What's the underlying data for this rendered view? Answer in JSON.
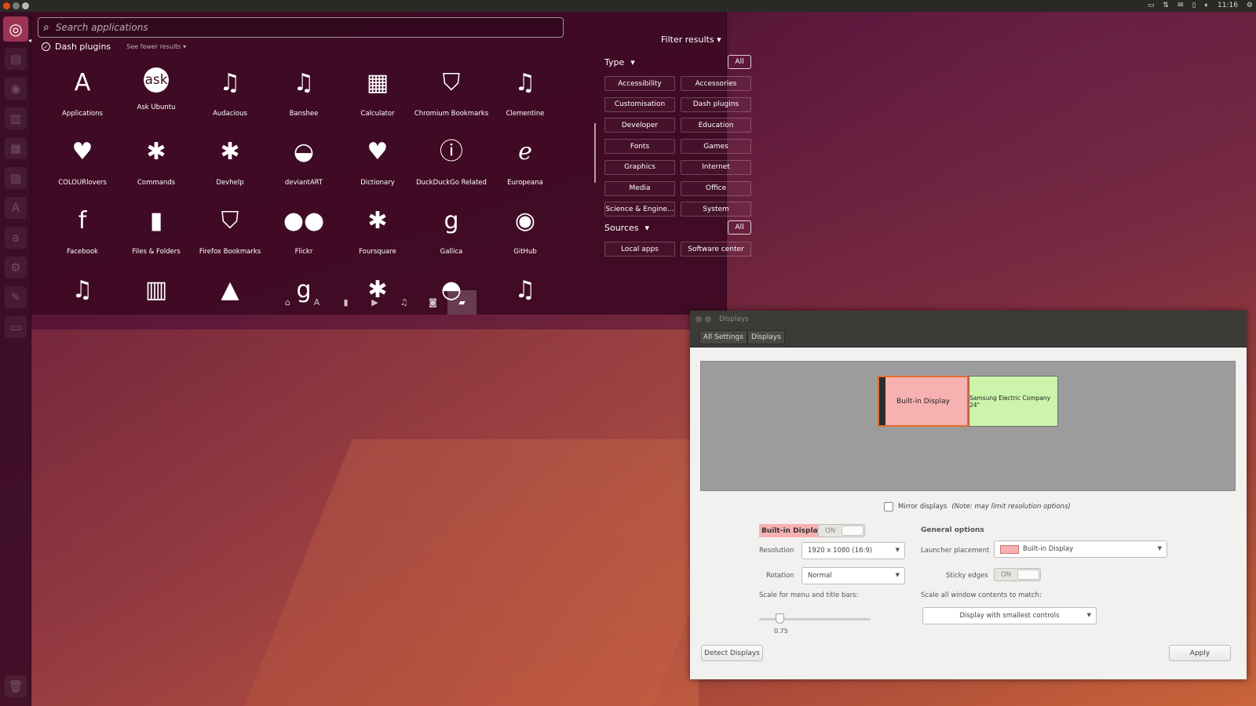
{
  "top_panel": {
    "time": "11:16",
    "tray_icons": [
      "network-icon",
      "transfer-icon",
      "mail-icon",
      "battery-icon",
      "volume-icon",
      "gear-icon"
    ]
  },
  "dash": {
    "search_placeholder": "Search applications",
    "category_title": "Dash plugins",
    "see_fewer": "See fewer results",
    "results": [
      {
        "label": "Applications",
        "icon": "A"
      },
      {
        "label": "Ask Ubuntu",
        "icon": "ask"
      },
      {
        "label": "Audacious",
        "icon": "♫"
      },
      {
        "label": "Banshee",
        "icon": "♫"
      },
      {
        "label": "Calculator",
        "icon": "▦"
      },
      {
        "label": "Chromium Bookmarks",
        "icon": "⛉"
      },
      {
        "label": "Clementine",
        "icon": "♫"
      },
      {
        "label": "COLOURlovers",
        "icon": "♥"
      },
      {
        "label": "Commands",
        "icon": "✱"
      },
      {
        "label": "Devhelp",
        "icon": "✱"
      },
      {
        "label": "deviantART",
        "icon": "◒"
      },
      {
        "label": "Dictionary",
        "icon": "♥"
      },
      {
        "label": "DuckDuckGo Related",
        "icon": "ⓘ"
      },
      {
        "label": "Europeana",
        "icon": "ℯ"
      },
      {
        "label": "Facebook",
        "icon": "f"
      },
      {
        "label": "Files & Folders",
        "icon": "▮"
      },
      {
        "label": "Firefox Bookmarks",
        "icon": "⛉"
      },
      {
        "label": "Flickr",
        "icon": "●●"
      },
      {
        "label": "Foursquare",
        "icon": "✱"
      },
      {
        "label": "Gallica",
        "icon": "g"
      },
      {
        "label": "GitHub",
        "icon": "◉"
      },
      {
        "label": "",
        "icon": "♫"
      },
      {
        "label": "",
        "icon": "▥"
      },
      {
        "label": "",
        "icon": "▲"
      },
      {
        "label": "",
        "icon": "g"
      },
      {
        "label": "",
        "icon": "✱"
      },
      {
        "label": "",
        "icon": "◓"
      },
      {
        "label": "",
        "icon": "♫"
      }
    ],
    "lenses": [
      {
        "name": "lens-home",
        "icon": "⌂"
      },
      {
        "name": "lens-applications",
        "icon": "A"
      },
      {
        "name": "lens-files",
        "icon": "▮"
      },
      {
        "name": "lens-video",
        "icon": "▶"
      },
      {
        "name": "lens-music",
        "icon": "♫"
      },
      {
        "name": "lens-photos",
        "icon": "◙"
      },
      {
        "name": "lens-social",
        "icon": "▰"
      }
    ]
  },
  "filters": {
    "title": "Filter results",
    "type_label": "Type",
    "all_label": "All",
    "type_buttons": [
      "Accessibility",
      "Accessories",
      "Customisation",
      "Dash plugins",
      "Developer",
      "Education",
      "Fonts",
      "Games",
      "Graphics",
      "Internet",
      "Media",
      "Office",
      "Science & Engine...",
      "System"
    ],
    "sources_label": "Sources",
    "source_buttons": [
      "Local apps",
      "Software center"
    ]
  },
  "displays": {
    "window_title": "Displays",
    "crumb_all": "All Settings",
    "crumb_current": "Displays",
    "monitor1": "Built-in Display",
    "monitor2": "Samsung Electric Company 24\"",
    "mirror_label": "Mirror displays",
    "mirror_note": "(Note: may limit resolution options)",
    "selected_display": "Built-in Display",
    "on_label": "ON",
    "resolution_label": "Resolution",
    "resolution_value": "1920 x 1080 (16:9)",
    "rotation_label": "Rotation",
    "rotation_value": "Normal",
    "scale_label": "Scale for menu and title bars:",
    "scale_value": "0.75",
    "general_heading": "General options",
    "launcher_label": "Launcher placement",
    "launcher_value": "Built-in Display",
    "sticky_label": "Sticky edges",
    "scale_all_label": "Scale all window contents to match:",
    "scale_all_value": "Display with smallest controls",
    "detect_button": "Detect Displays",
    "apply_button": "Apply"
  }
}
